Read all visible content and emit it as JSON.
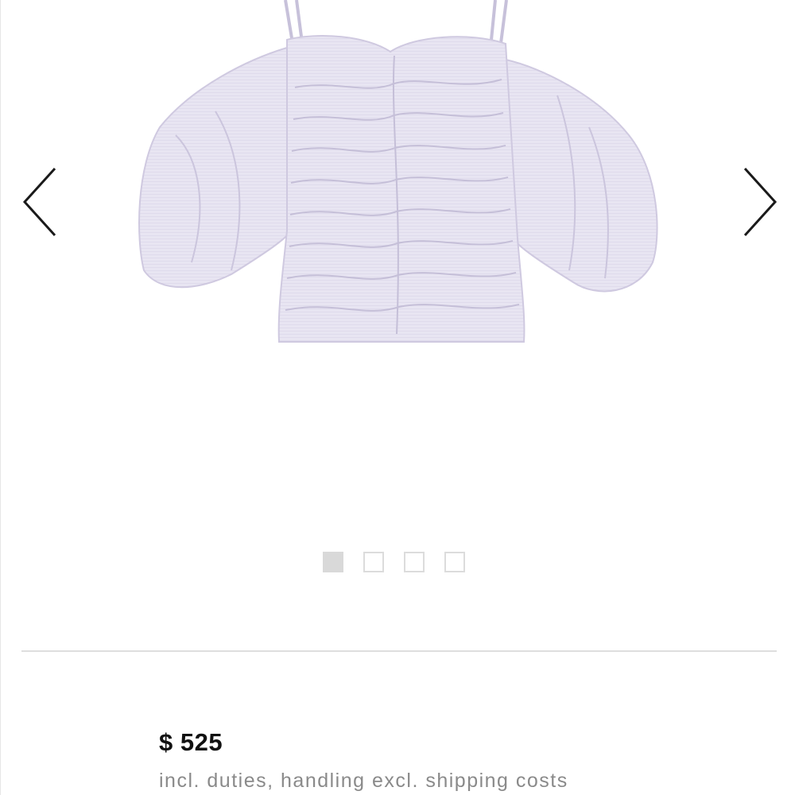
{
  "gallery": {
    "image_alt": "Off-shoulder ruched top with puff sleeves",
    "prev_icon": "chevron-left-icon",
    "next_icon": "chevron-right-icon",
    "slides_total": 4,
    "active_slide": 1
  },
  "product": {
    "price": "$ 525",
    "price_note": "incl. duties, handling excl. shipping costs"
  },
  "colors": {
    "garment": "#e6e3f1",
    "garment_shadow": "#c9c4dc",
    "arrow": "#1a1a1a",
    "dot_active": "#d9d9d9",
    "divider": "#dedede",
    "price": "#111111",
    "note": "#8a8a8a"
  }
}
